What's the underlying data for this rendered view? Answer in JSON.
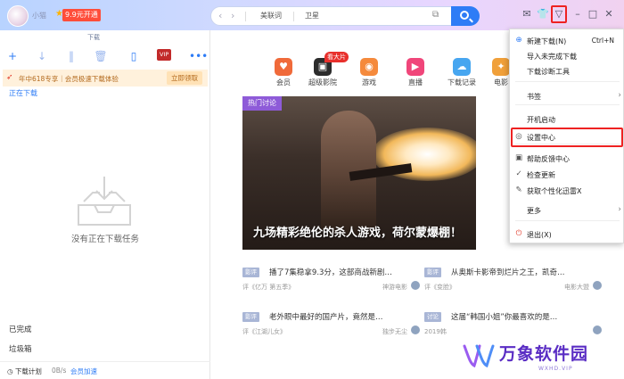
{
  "titlebar": {
    "username": "小猫",
    "vip_label": "9.9元开通",
    "nav_tag": "美联词",
    "nav_query": "卫星"
  },
  "left": {
    "tab_label": "下载",
    "vip_badge": "VIP",
    "promo_text": "年中618专享｜会员极速下载体验",
    "promo_button": "立即领取",
    "section_downloading": "正在下载",
    "empty_text": "没有正在下载任务",
    "section_done": "已完成",
    "section_trash": "垃圾箱",
    "plan_label": "下载计划",
    "speed": "0B/s",
    "vip_accel": "会员加速"
  },
  "categories": [
    {
      "label": "会员",
      "icon": "heart-icon",
      "color": "#f06a3a"
    },
    {
      "label": "超级影院",
      "icon": "film-icon",
      "color": "#2c2c2c",
      "badge": "看大片"
    },
    {
      "label": "游戏",
      "icon": "gamepad-icon",
      "color": "#f58a3c"
    },
    {
      "label": "直播",
      "icon": "tv-icon",
      "color": "#f0467a"
    },
    {
      "label": "下载记录",
      "icon": "cloud-icon",
      "color": "#47a6f0"
    },
    {
      "label": "电影",
      "icon": "movie-icon",
      "color": "#f0a03a"
    }
  ],
  "hero": {
    "tag": "热门讨论",
    "title": "九场精彩绝伦的杀人游戏，荷尔蒙爆棚！"
  },
  "news": [
    {
      "tag": "影评",
      "title": "播了7集稳拿9.3分，这部商战新剧…",
      "sub": "评《亿万 第五季》",
      "source": "神游电影"
    },
    {
      "tag": "影评",
      "title": "从奥斯卡影帝到烂片之王，凯奇…",
      "sub": "评《变脸》",
      "source": "电影大盟"
    },
    {
      "tag": "影评",
      "title": "老外眼中最好的国产片，竟然是…",
      "sub": "评《江湖儿女》",
      "source": "独步无尘"
    },
    {
      "tag": "讨论",
      "title": "这届“韩国小姐”你最喜欢的是…",
      "sub": "2019韩",
      "source": ""
    }
  ],
  "watermark": {
    "text": "万象软件园",
    "sub": "WXHD.VIP"
  },
  "menu": {
    "items": [
      {
        "label": "新建下载(N)",
        "shortcut": "Ctrl+N",
        "icon": "new-download-icon"
      },
      {
        "label": "导入未完成下载",
        "icon": ""
      },
      {
        "label": "下载诊断工具",
        "icon": ""
      },
      {
        "label": "书签",
        "icon": "",
        "submenu": true
      },
      {
        "label": "开机启动",
        "icon": ""
      },
      {
        "label": "设置中心",
        "icon": "settings-icon",
        "highlighted": true
      },
      {
        "label": "帮助反馈中心",
        "icon": "help-icon"
      },
      {
        "label": "检查更新",
        "icon": "update-icon"
      },
      {
        "label": "获取个性化迅雷X",
        "icon": "personalize-icon"
      },
      {
        "label": "更多",
        "icon": "",
        "submenu": true
      },
      {
        "label": "退出(X)",
        "icon": "exit-icon"
      }
    ]
  }
}
